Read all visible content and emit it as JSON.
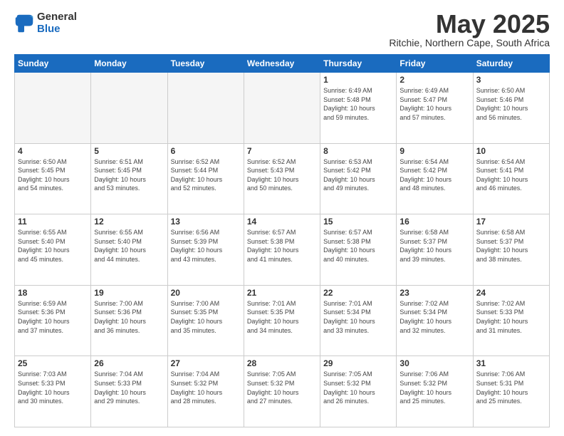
{
  "logo": {
    "general": "General",
    "blue": "Blue"
  },
  "header": {
    "month": "May 2025",
    "location": "Ritchie, Northern Cape, South Africa"
  },
  "days": [
    "Sunday",
    "Monday",
    "Tuesday",
    "Wednesday",
    "Thursday",
    "Friday",
    "Saturday"
  ],
  "weeks": [
    [
      {
        "day": "",
        "info": ""
      },
      {
        "day": "",
        "info": ""
      },
      {
        "day": "",
        "info": ""
      },
      {
        "day": "",
        "info": ""
      },
      {
        "day": "1",
        "info": "Sunrise: 6:49 AM\nSunset: 5:48 PM\nDaylight: 10 hours\nand 59 minutes."
      },
      {
        "day": "2",
        "info": "Sunrise: 6:49 AM\nSunset: 5:47 PM\nDaylight: 10 hours\nand 57 minutes."
      },
      {
        "day": "3",
        "info": "Sunrise: 6:50 AM\nSunset: 5:46 PM\nDaylight: 10 hours\nand 56 minutes."
      }
    ],
    [
      {
        "day": "4",
        "info": "Sunrise: 6:50 AM\nSunset: 5:45 PM\nDaylight: 10 hours\nand 54 minutes."
      },
      {
        "day": "5",
        "info": "Sunrise: 6:51 AM\nSunset: 5:45 PM\nDaylight: 10 hours\nand 53 minutes."
      },
      {
        "day": "6",
        "info": "Sunrise: 6:52 AM\nSunset: 5:44 PM\nDaylight: 10 hours\nand 52 minutes."
      },
      {
        "day": "7",
        "info": "Sunrise: 6:52 AM\nSunset: 5:43 PM\nDaylight: 10 hours\nand 50 minutes."
      },
      {
        "day": "8",
        "info": "Sunrise: 6:53 AM\nSunset: 5:42 PM\nDaylight: 10 hours\nand 49 minutes."
      },
      {
        "day": "9",
        "info": "Sunrise: 6:54 AM\nSunset: 5:42 PM\nDaylight: 10 hours\nand 48 minutes."
      },
      {
        "day": "10",
        "info": "Sunrise: 6:54 AM\nSunset: 5:41 PM\nDaylight: 10 hours\nand 46 minutes."
      }
    ],
    [
      {
        "day": "11",
        "info": "Sunrise: 6:55 AM\nSunset: 5:40 PM\nDaylight: 10 hours\nand 45 minutes."
      },
      {
        "day": "12",
        "info": "Sunrise: 6:55 AM\nSunset: 5:40 PM\nDaylight: 10 hours\nand 44 minutes."
      },
      {
        "day": "13",
        "info": "Sunrise: 6:56 AM\nSunset: 5:39 PM\nDaylight: 10 hours\nand 43 minutes."
      },
      {
        "day": "14",
        "info": "Sunrise: 6:57 AM\nSunset: 5:38 PM\nDaylight: 10 hours\nand 41 minutes."
      },
      {
        "day": "15",
        "info": "Sunrise: 6:57 AM\nSunset: 5:38 PM\nDaylight: 10 hours\nand 40 minutes."
      },
      {
        "day": "16",
        "info": "Sunrise: 6:58 AM\nSunset: 5:37 PM\nDaylight: 10 hours\nand 39 minutes."
      },
      {
        "day": "17",
        "info": "Sunrise: 6:58 AM\nSunset: 5:37 PM\nDaylight: 10 hours\nand 38 minutes."
      }
    ],
    [
      {
        "day": "18",
        "info": "Sunrise: 6:59 AM\nSunset: 5:36 PM\nDaylight: 10 hours\nand 37 minutes."
      },
      {
        "day": "19",
        "info": "Sunrise: 7:00 AM\nSunset: 5:36 PM\nDaylight: 10 hours\nand 36 minutes."
      },
      {
        "day": "20",
        "info": "Sunrise: 7:00 AM\nSunset: 5:35 PM\nDaylight: 10 hours\nand 35 minutes."
      },
      {
        "day": "21",
        "info": "Sunrise: 7:01 AM\nSunset: 5:35 PM\nDaylight: 10 hours\nand 34 minutes."
      },
      {
        "day": "22",
        "info": "Sunrise: 7:01 AM\nSunset: 5:34 PM\nDaylight: 10 hours\nand 33 minutes."
      },
      {
        "day": "23",
        "info": "Sunrise: 7:02 AM\nSunset: 5:34 PM\nDaylight: 10 hours\nand 32 minutes."
      },
      {
        "day": "24",
        "info": "Sunrise: 7:02 AM\nSunset: 5:33 PM\nDaylight: 10 hours\nand 31 minutes."
      }
    ],
    [
      {
        "day": "25",
        "info": "Sunrise: 7:03 AM\nSunset: 5:33 PM\nDaylight: 10 hours\nand 30 minutes."
      },
      {
        "day": "26",
        "info": "Sunrise: 7:04 AM\nSunset: 5:33 PM\nDaylight: 10 hours\nand 29 minutes."
      },
      {
        "day": "27",
        "info": "Sunrise: 7:04 AM\nSunset: 5:32 PM\nDaylight: 10 hours\nand 28 minutes."
      },
      {
        "day": "28",
        "info": "Sunrise: 7:05 AM\nSunset: 5:32 PM\nDaylight: 10 hours\nand 27 minutes."
      },
      {
        "day": "29",
        "info": "Sunrise: 7:05 AM\nSunset: 5:32 PM\nDaylight: 10 hours\nand 26 minutes."
      },
      {
        "day": "30",
        "info": "Sunrise: 7:06 AM\nSunset: 5:32 PM\nDaylight: 10 hours\nand 25 minutes."
      },
      {
        "day": "31",
        "info": "Sunrise: 7:06 AM\nSunset: 5:31 PM\nDaylight: 10 hours\nand 25 minutes."
      }
    ]
  ]
}
